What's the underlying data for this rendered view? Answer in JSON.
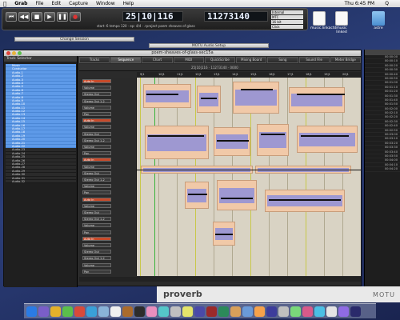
{
  "menubar": {
    "apple": "",
    "items": [
      "Grab",
      "File",
      "Edit",
      "Capture",
      "Window",
      "Help"
    ],
    "clock": "Thu 6:45 PM",
    "spotlight": "Q"
  },
  "transport": {
    "buttons": [
      "⏮",
      "◀◀",
      "■",
      "▶",
      "❚❚",
      "●"
    ],
    "counter_time": "25|10|116",
    "counter_samples": "11273140",
    "tempo_line": "start: 6 tempo 120 · ep: 4/4 · ♪project poem sheaves of glass",
    "selectors": [
      "Internal",
      "MTC",
      "16 bit",
      "Click"
    ]
  },
  "desktop": {
    "icons": [
      {
        "name": "music",
        "label": "music.linkactd"
      },
      {
        "name": "doc",
        "label": "music linked"
      },
      {
        "name": "astre",
        "label": "astre"
      }
    ]
  },
  "mini_windows": [
    "Change Session",
    "MOTU Audio Setup"
  ],
  "window": {
    "title": "poem-sheaves-of-glass-sec15a",
    "track_selector_title": "Track Selector",
    "tabs": [
      "Tracks",
      "Sequence",
      "Chart",
      "MIDI",
      "QuickScribe",
      "Mixing Board",
      "Song",
      "Sound File",
      "Meter Bridge"
    ],
    "active_tab": "Sequence",
    "toolbar_text": "25|10|116 · 11273140 · 0000",
    "tracks": [
      "Music",
      "Conductor",
      "Audio-1",
      "Audio-2",
      "Audio-3",
      "Audio-4",
      "Audio-5",
      "Audio-6",
      "Audio-7",
      "Audio-8",
      "Audio-9",
      "Audio-10",
      "Audio-11",
      "Audio-12",
      "Audio-13",
      "Audio-14",
      "Audio-15",
      "Audio-16",
      "Audio-17",
      "Audio-18",
      "Audio-19",
      "Audio-20",
      "Audio-21",
      "Audio-22",
      "Audio-23",
      "Audio-24",
      "Audio-25",
      "Audio-26",
      "Audio-27",
      "Audio-28",
      "Audio-29",
      "Audio-30",
      "Audio-31",
      "Audio-32"
    ],
    "ruler": [
      "9|1",
      "10|1",
      "11|1",
      "12|1",
      "13|1",
      "14|1",
      "15|1",
      "16|1",
      "17|1",
      "18|1",
      "19|1",
      "20|1"
    ],
    "controls": [
      "Auto In",
      "Volume",
      "Stereo Out",
      "Stereo Out 1-2",
      "Volume",
      "Pan"
    ]
  },
  "right_list": [
    "00:00:00",
    "00:00:10",
    "00:00:20",
    "00:00:30",
    "00:00:40",
    "00:00:50",
    "00:01:00",
    "00:01:10",
    "00:01:20",
    "00:01:30",
    "00:01:40",
    "00:01:50",
    "00:02:00",
    "00:02:10",
    "00:02:20",
    "00:02:30",
    "00:02:40",
    "00:02:50",
    "00:03:00",
    "00:03:10",
    "00:03:20",
    "00:03:30",
    "00:03:40",
    "00:03:50",
    "00:04:00",
    "00:04:10",
    "00:04:20"
  ],
  "footer": {
    "brand": "proverb",
    "maker": "MOTU"
  },
  "dock_colors": [
    "#2a7be4",
    "#7a5ec8",
    "#e4b12a",
    "#5bbf4b",
    "#d84a3a",
    "#3aa0d8",
    "#8ab3d8",
    "#f0f0f0",
    "#aa6b2c",
    "#2c2c2c",
    "#e98fbe",
    "#55c6c9",
    "#c0c0c0",
    "#e4e46b",
    "#4a4aa8",
    "#9b2a2a",
    "#2c8a5a",
    "#d8a05a",
    "#6a9ad8",
    "#f6a24b",
    "#3d3d9b",
    "#bfbfbf",
    "#7ad87a",
    "#d85a8a",
    "#4bbfe4",
    "#e4e4e4",
    "#8f6be4",
    "#2a2a6b"
  ]
}
